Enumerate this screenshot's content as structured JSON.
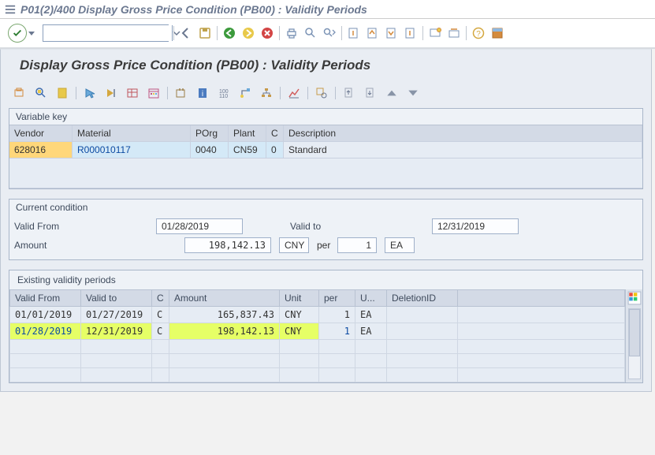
{
  "window": {
    "title": "P01(2)/400 Display Gross Price Condition (PB00) : Validity Periods"
  },
  "screen_title": "Display Gross Price Condition (PB00) : Validity Periods",
  "variable_key": {
    "title": "Variable key",
    "headers": {
      "vendor": "Vendor",
      "material": "Material",
      "porg": "POrg",
      "plant": "Plant",
      "c": "C",
      "desc": "Description"
    },
    "row": {
      "vendor": "628016",
      "material": "R000010117",
      "porg": "0040",
      "plant": "CN59",
      "c": "0",
      "desc": "Standard"
    }
  },
  "current_condition": {
    "title": "Current condition",
    "labels": {
      "valid_from": "Valid From",
      "valid_to": "Valid to",
      "amount": "Amount",
      "per": "per"
    },
    "values": {
      "valid_from": "01/28/2019",
      "valid_to": "12/31/2019",
      "amount": "198,142.13",
      "currency": "CNY",
      "per_qty": "1",
      "per_unit": "EA"
    }
  },
  "existing_periods": {
    "title": "Existing validity periods",
    "headers": {
      "valid_from": "Valid From",
      "valid_to": "Valid to",
      "c": "C",
      "amount": "Amount",
      "unit": "Unit",
      "per": "per",
      "u": "U...",
      "del": "DeletionID"
    },
    "rows": [
      {
        "valid_from": "01/01/2019",
        "valid_to": "01/27/2019",
        "c": "C",
        "amount": "165,837.43",
        "unit": "CNY",
        "per": "1",
        "u": "EA",
        "del": ""
      },
      {
        "valid_from": "01/28/2019",
        "valid_to": "12/31/2019",
        "c": "C",
        "amount": "198,142.13",
        "unit": "CNY",
        "per": "1",
        "u": "EA",
        "del": ""
      }
    ]
  }
}
